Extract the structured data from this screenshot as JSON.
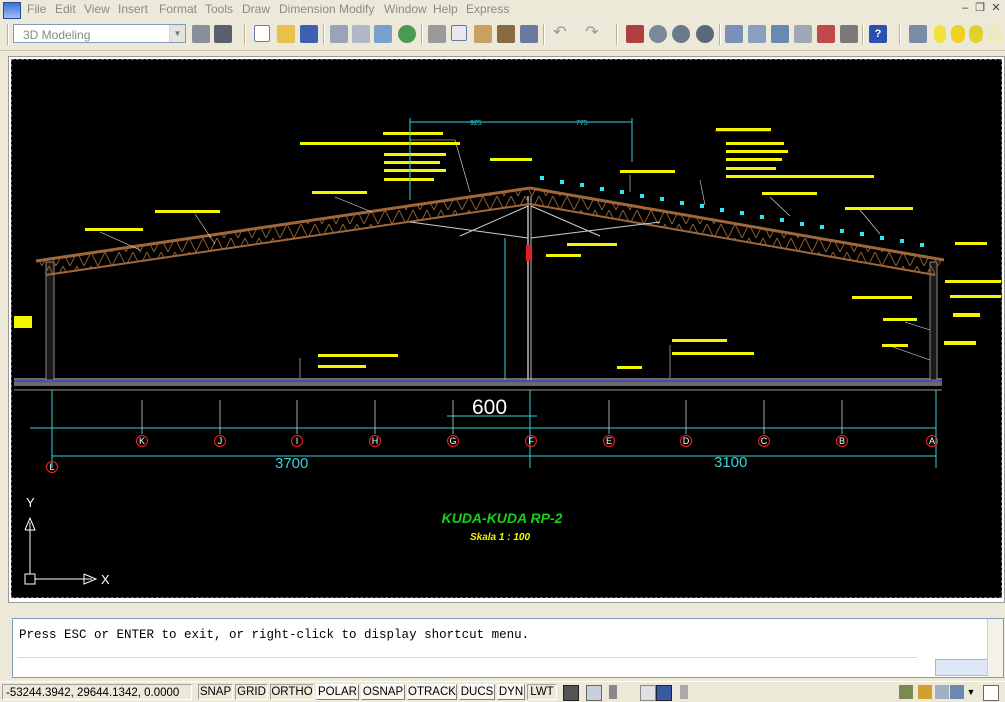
{
  "menu": {
    "items": [
      "File",
      "Edit",
      "View",
      "Insert",
      "Format",
      "Tools",
      "Draw",
      "Dimension",
      "Modify",
      "Window",
      "Help",
      "Express"
    ]
  },
  "workspace": {
    "selected": "3D Modeling"
  },
  "drawing": {
    "title": "KUDA-KUDA RP-2",
    "scale": "Skala 1 : 100",
    "height_dim": "600",
    "span_left": "3700",
    "span_right": "3100",
    "top_dim_left": "925",
    "top_dim_right": "775",
    "axis_labels": [
      "L",
      "K",
      "J",
      "I",
      "H",
      "G",
      "F",
      "E",
      "D",
      "C",
      "B",
      "A"
    ],
    "ucs_x": "X",
    "ucs_y": "Y",
    "colors": {
      "truss": "#8b5a2b",
      "dim": "#3bd0d8",
      "text": "#f5f500",
      "title": "#18d018",
      "axis": "#ff2020",
      "background": "#000000"
    }
  },
  "command": {
    "prompt": "Press ESC or ENTER to exit, or right-click to display shortcut menu."
  },
  "status": {
    "coords": "-53244.3942, 29644.1342, 0.0000",
    "toggles": [
      {
        "label": "SNAP",
        "on": false
      },
      {
        "label": "GRID",
        "on": false
      },
      {
        "label": "ORTHO",
        "on": false
      },
      {
        "label": "POLAR",
        "on": true
      },
      {
        "label": "OSNAP",
        "on": true
      },
      {
        "label": "OTRACK",
        "on": true
      },
      {
        "label": "DUCS",
        "on": true
      },
      {
        "label": "DYN",
        "on": true
      },
      {
        "label": "LWT",
        "on": false
      }
    ]
  }
}
